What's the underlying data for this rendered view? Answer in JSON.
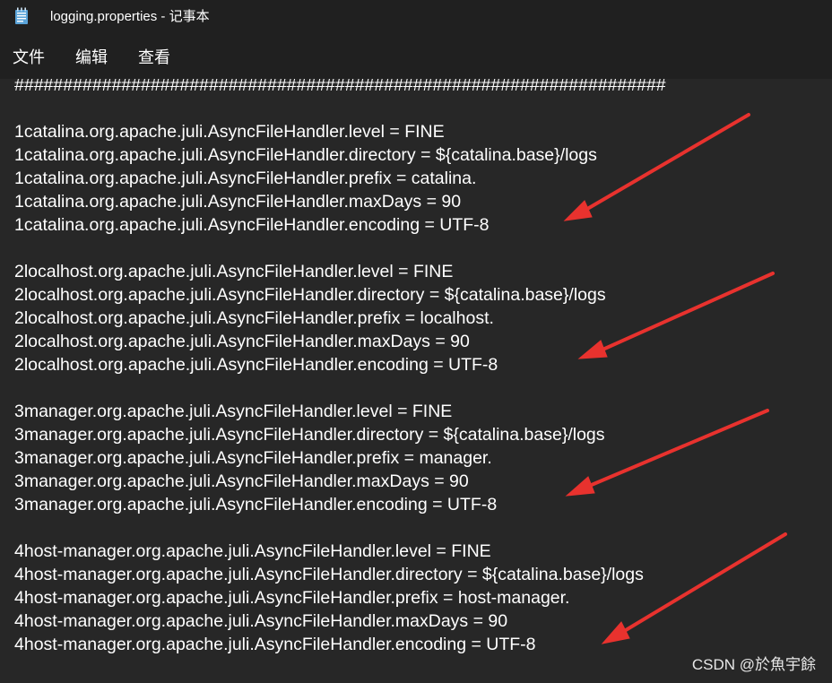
{
  "window": {
    "title": "logging.properties - 记事本"
  },
  "menu": {
    "items": [
      {
        "label": "文件"
      },
      {
        "label": "编辑"
      },
      {
        "label": "查看"
      }
    ]
  },
  "editor": {
    "lines": [
      "###################################################################",
      "",
      "1catalina.org.apache.juli.AsyncFileHandler.level = FINE",
      "1catalina.org.apache.juli.AsyncFileHandler.directory = ${catalina.base}/logs",
      "1catalina.org.apache.juli.AsyncFileHandler.prefix = catalina.",
      "1catalina.org.apache.juli.AsyncFileHandler.maxDays = 90",
      "1catalina.org.apache.juli.AsyncFileHandler.encoding = UTF-8",
      "",
      "2localhost.org.apache.juli.AsyncFileHandler.level = FINE",
      "2localhost.org.apache.juli.AsyncFileHandler.directory = ${catalina.base}/logs",
      "2localhost.org.apache.juli.AsyncFileHandler.prefix = localhost.",
      "2localhost.org.apache.juli.AsyncFileHandler.maxDays = 90",
      "2localhost.org.apache.juli.AsyncFileHandler.encoding = UTF-8",
      "",
      "3manager.org.apache.juli.AsyncFileHandler.level = FINE",
      "3manager.org.apache.juli.AsyncFileHandler.directory = ${catalina.base}/logs",
      "3manager.org.apache.juli.AsyncFileHandler.prefix = manager.",
      "3manager.org.apache.juli.AsyncFileHandler.maxDays = 90",
      "3manager.org.apache.juli.AsyncFileHandler.encoding = UTF-8",
      "",
      "4host-manager.org.apache.juli.AsyncFileHandler.level = FINE",
      "4host-manager.org.apache.juli.AsyncFileHandler.directory = ${catalina.base}/logs",
      "4host-manager.org.apache.juli.AsyncFileHandler.prefix = host-manager.",
      "4host-manager.org.apache.juli.AsyncFileHandler.maxDays = 90",
      "4host-manager.org.apache.juli.AsyncFileHandler.encoding = UTF-8"
    ]
  },
  "annotations": {
    "arrow_color": "#e8322e",
    "arrow_count": 4
  },
  "watermark": {
    "text": "CSDN @於魚宇餘"
  },
  "colors": {
    "titlebar_bg": "#202020",
    "editor_bg": "#272727",
    "text": "#ffffff"
  },
  "icons": {
    "app": "notepad-icon"
  }
}
